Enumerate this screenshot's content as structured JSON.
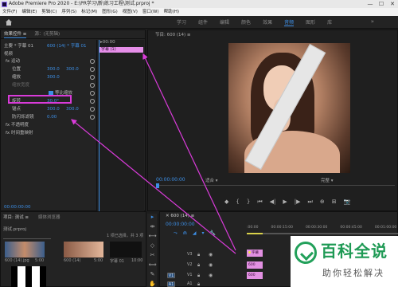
{
  "window": {
    "title": "Adobe Premiere Pro 2020 - E:\\PR学习\\新\\练习工程\\测试.prproj *",
    "controls": [
      "—",
      "☐",
      "✕"
    ]
  },
  "menu": [
    "文件(F)",
    "编辑(E)",
    "剪辑(C)",
    "序列(S)",
    "标记(M)",
    "图形(G)",
    "视图(V)",
    "窗口(W)",
    "帮助(H)"
  ],
  "workspace": {
    "tabs": [
      "学习",
      "组件",
      "编辑",
      "颜色",
      "效果",
      "音频",
      "图形",
      "库"
    ],
    "active": "音频",
    "more": "»"
  },
  "effect_controls": {
    "tabs": [
      "效果控件 ≡",
      "源：(无剪辑)"
    ],
    "header_left": "主要 * 字幕 01",
    "header_right": "600 (14) * 字幕 01",
    "timecode_ruler": "▸00:00",
    "clip_label": "字幕 (1)",
    "section_video": "视频",
    "motion": "fx  运动",
    "position_label": "位置",
    "position_x": "300.0",
    "position_y": "300.0",
    "scale_label": "缩放",
    "scale_value": "300.0",
    "scale_width_label": "缩放宽度",
    "uniform_scale": "等比缩放",
    "rotation_label": "旋转",
    "rotation_value": "30.0°",
    "anchor_label": "锚点",
    "anchor_x": "300.0",
    "anchor_y": "300.0",
    "anti_flicker_label": "防闪烁滤镜",
    "anti_flicker_value": "0.00",
    "opacity": "fx  不透明度",
    "time_remap": "fx  时间重映射",
    "timecode": "00:00:00:00"
  },
  "program_monitor": {
    "title": "节目: 600 (14) ≡",
    "timecode": "00:00:00:00",
    "fit": "适合",
    "quality": "完整",
    "transport": [
      "◆",
      "{",
      "}",
      "⏮",
      "◀|",
      "▶",
      "|▶",
      "⏭",
      "⊕",
      "⊞",
      "📷"
    ]
  },
  "project": {
    "tabs": [
      "项目: 测试 ≡",
      "媒体浏览器"
    ],
    "file": "测试.prproj",
    "count": "1 项已选择，共 3 项",
    "thumbs": [
      {
        "name": "600 (14).jpg",
        "dur": "5:00"
      },
      {
        "name": "600 (14)",
        "dur": "5:00"
      },
      {
        "name": "字幕 01",
        "dur": "10:00"
      }
    ]
  },
  "tools": [
    "▸",
    "⇹",
    "⟷",
    "◇",
    "✂",
    "⟺",
    "✎",
    "✋",
    "T"
  ],
  "timeline": {
    "title": "✕  600 (14) ≡",
    "timecode": "00:00:00:00",
    "ruler": [
      ":00:00",
      "00:00:15:00",
      "00:00:30:00",
      "00:00:45:00",
      "00:01:00:00",
      "00:0"
    ],
    "tool_icons": [
      "⤳",
      "⋒",
      "◢",
      "▾",
      "🔧"
    ],
    "tracks": [
      {
        "id": "V3",
        "kind": "v"
      },
      {
        "id": "V2",
        "kind": "v"
      },
      {
        "id": "V1",
        "kind": "v",
        "target": "V1"
      },
      {
        "id": "A1",
        "kind": "a",
        "target": "A1"
      }
    ],
    "clips": [
      {
        "label": "字幕",
        "track": "V3"
      },
      {
        "label": "600",
        "track": "V2"
      },
      {
        "label": "600",
        "track": "V1"
      }
    ]
  },
  "watermark": {
    "title": "百科全说",
    "subtitle": "助你轻松解决"
  },
  "colors": {
    "accent_blue": "#3d8fe6",
    "highlight_magenta": "#d93bd9",
    "clip_pink": "#e290e2",
    "watermark_green": "#1f9a55"
  }
}
